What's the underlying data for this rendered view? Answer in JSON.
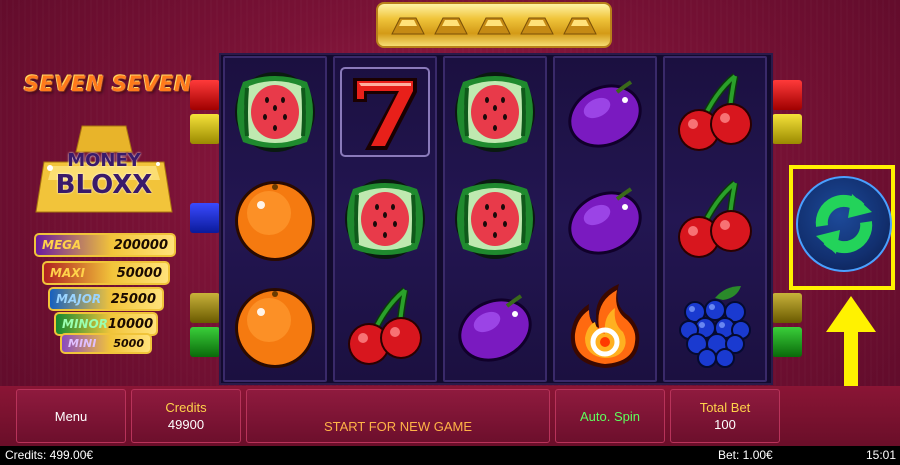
{
  "game": {
    "logo_line1": "SEVEN SEVEN",
    "logo_line2a": "MONEY",
    "logo_line2b": "BLOXX"
  },
  "jackpots": [
    {
      "name": "MEGA",
      "value": "200000",
      "color": "#7a2ab0"
    },
    {
      "name": "MAXI",
      "value": "50000",
      "color": "#c0392b"
    },
    {
      "name": "MAJOR",
      "value": "25000",
      "color": "#1a6fd0"
    },
    {
      "name": "MINOR",
      "value": "10000",
      "color": "#1e9a3a"
    },
    {
      "name": "MINI",
      "value": "5000",
      "color": "#9a5ad0"
    }
  ],
  "reels": [
    [
      "watermelon",
      "orange",
      "orange"
    ],
    [
      "seven",
      "watermelon",
      "cherry"
    ],
    [
      "watermelon",
      "watermelon",
      "plum"
    ],
    [
      "plum",
      "plum",
      "fire"
    ],
    [
      "cherry",
      "cherry",
      "grapes"
    ]
  ],
  "controls": {
    "menu": "Menu",
    "credits_label": "Credits",
    "credits_value": "49900",
    "start": "START FOR NEW GAME",
    "autospin": "Auto. Spin",
    "totalbet_label": "Total Bet",
    "totalbet_value": "100"
  },
  "status": {
    "credits": "Credits: 499.00€",
    "bet": "Bet: 1.00€",
    "time": "15:01"
  },
  "colors": {
    "highlight": "#fff200",
    "autospin_text": "#5dff5d",
    "start_text": "#ffb347",
    "ctrl_text": "#ffffff",
    "gold_text": "#ffd24a"
  },
  "icons": {
    "spin": "refresh-arrows-icon",
    "pointer": "up-arrow-icon"
  }
}
